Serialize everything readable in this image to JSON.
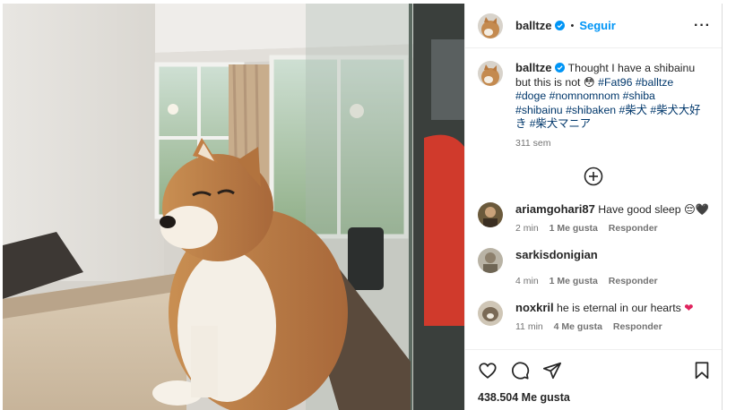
{
  "post": {
    "username": "balltze",
    "follow_label": "Seguir",
    "separator": "•",
    "more_label": "···",
    "caption_prefix": "Thought I have a shibainu but this is not",
    "caption_emoji": "😳",
    "hashtags_line1": "#Fat96 #balltze",
    "hashtags_line2": "#doge #nomnomnom #shiba",
    "hashtags_line3": "#shibainu #shibaken #柴犬 #柴犬大好",
    "hashtags_line4": "き #柴犬マニア",
    "time": "311 sem"
  },
  "comments": [
    {
      "username": "ariamgohari87",
      "text": "Have good sleep",
      "emoji": "😔🖤",
      "time": "2 min",
      "likes": "1 Me gusta",
      "reply": "Responder"
    },
    {
      "username": "sarkisdonigian",
      "text": "",
      "emoji": "",
      "time": "4 min",
      "likes": "1 Me gusta",
      "reply": "Responder"
    },
    {
      "username": "noxkril",
      "text": "he is eternal in our hearts",
      "emoji": "❤",
      "time": "11 min",
      "likes": "4 Me gusta",
      "reply": "Responder"
    }
  ],
  "actions": {
    "like_icon": "heart-icon",
    "comment_icon": "comment-icon",
    "share_icon": "share-icon",
    "save_icon": "bookmark-icon",
    "likes_count": "438.504 Me gusta"
  },
  "colors": {
    "link": "#0095f6",
    "hashtag": "#00376b",
    "muted": "#737373",
    "verified": "#0095f6"
  }
}
